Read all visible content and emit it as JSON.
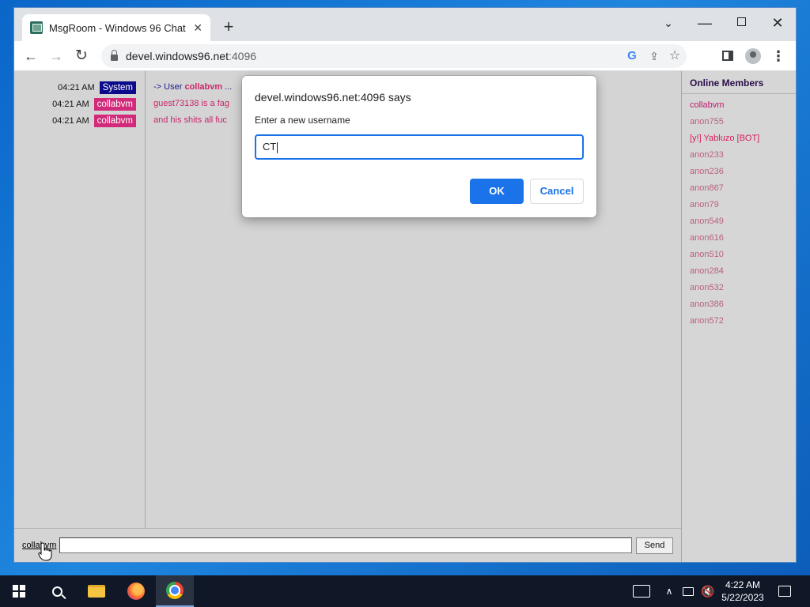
{
  "browser": {
    "tab_title": "MsgRoom - Windows 96 Chat",
    "tab_close": "✕",
    "new_tab": "+",
    "url_host": "devel.windows96.net",
    "url_port": ":4096"
  },
  "chat": {
    "log": [
      {
        "time": "04:21 AM",
        "author": "System",
        "type": "system",
        "prefix": "-> User ",
        "name": "collabvm",
        "suffix": " ..."
      },
      {
        "time": "04:21 AM",
        "author": "collabvm",
        "type": "user",
        "text": "guest73138 is a fag"
      },
      {
        "time": "04:21 AM",
        "author": "collabvm",
        "type": "user",
        "text": "and his shits all fuc"
      }
    ],
    "nickname": "collabvm",
    "send_label": "Send"
  },
  "members": {
    "title": "Online Members",
    "list": [
      "collabvm",
      "anon755",
      "[y!] Yabluzo [BOT]",
      "anon233",
      "anon236",
      "anon867",
      "anon79",
      "anon549",
      "anon616",
      "anon510",
      "anon284",
      "anon532",
      "anon386",
      "anon572"
    ]
  },
  "dialog": {
    "title": "devel.windows96.net:4096 says",
    "message": "Enter a new username",
    "input_value": "CT",
    "ok_label": "OK",
    "cancel_label": "Cancel"
  },
  "taskbar": {
    "time": "4:22 AM",
    "date": "5/22/2023"
  },
  "colors": {
    "system_badge": "#0a0a8a",
    "user_badge": "#d3297a",
    "accent": "#1a73e8"
  }
}
